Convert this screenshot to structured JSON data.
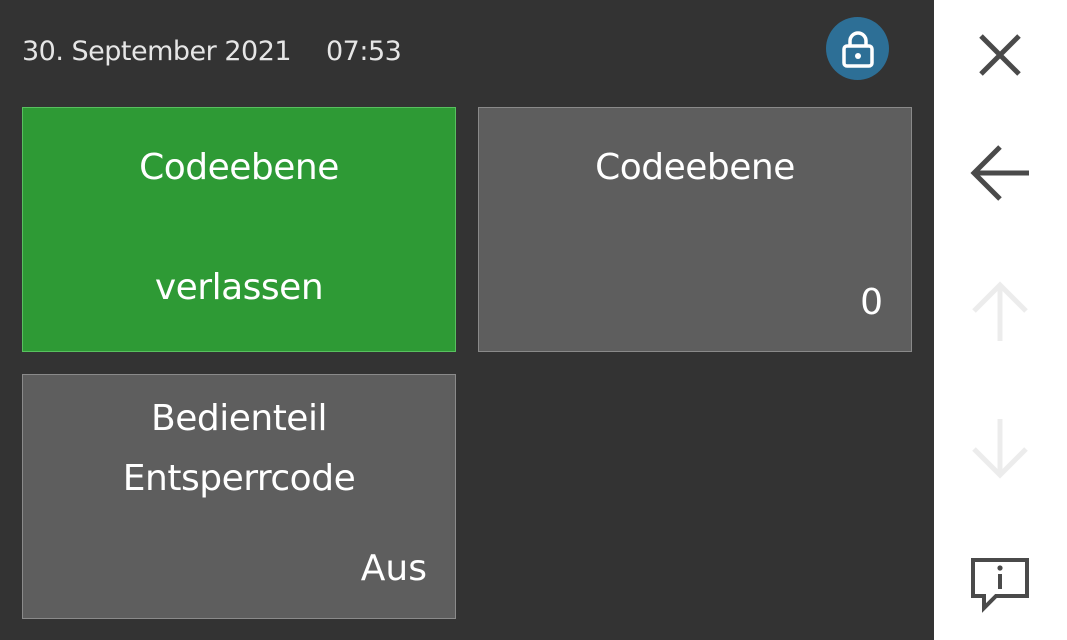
{
  "status": {
    "date": "30. September 2021",
    "time": "07:53"
  },
  "tiles": [
    {
      "line1": "Codeebene",
      "line2": "verlassen",
      "value": "",
      "color": "#2e9a35"
    },
    {
      "line1": "Codeebene",
      "line2": "",
      "value": "0",
      "color": "#5e5e5e"
    },
    {
      "line1": "Bedienteil",
      "line2": "Entsperrcode",
      "value": "Aus",
      "color": "#5e5e5e"
    }
  ],
  "sidebar": {
    "icons": [
      "close-icon",
      "back-arrow-icon",
      "arrow-up-icon",
      "arrow-down-icon",
      "info-icon"
    ],
    "disabled": [
      "arrow-up-icon",
      "arrow-down-icon"
    ]
  },
  "colors": {
    "background": "#333333",
    "accent_green": "#2e9a35",
    "tile_grey": "#5e5e5e",
    "lock_blue": "#2d6f96"
  }
}
